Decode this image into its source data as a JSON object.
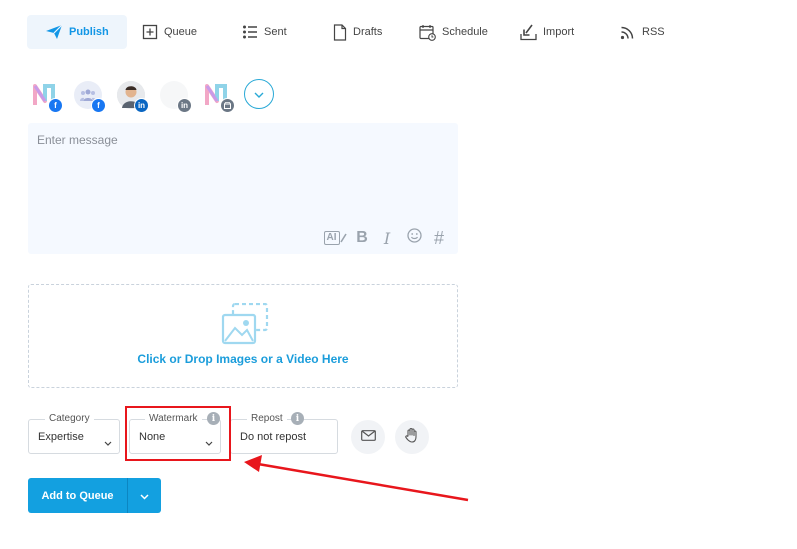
{
  "tabs": {
    "publish": "Publish",
    "queue": "Queue",
    "sent": "Sent",
    "drafts": "Drafts",
    "schedule": "Schedule",
    "import": "Import",
    "rss": "RSS"
  },
  "accounts": [
    {
      "icon": "brand-logo-icon",
      "network": "facebook",
      "badge": "f",
      "badge_color": "#1877f2"
    },
    {
      "icon": "group-icon",
      "network": "facebook",
      "badge": "f",
      "badge_color": "#1877f2"
    },
    {
      "icon": "person-avatar-icon",
      "network": "linkedin",
      "badge": "in",
      "badge_color": "#0a66c2"
    },
    {
      "icon": "empty-avatar-icon",
      "network": "linkedin",
      "badge": "in",
      "badge_color": "#6b7785"
    },
    {
      "icon": "brand-logo-icon",
      "network": "google-business",
      "badge": "g",
      "badge_color": "#6b7785"
    }
  ],
  "message": {
    "placeholder": "Enter message",
    "value": ""
  },
  "toolbar": {
    "ai_label": "AI",
    "bold_label": "B",
    "italic_label": "I",
    "hashtag_label": "#"
  },
  "upload": {
    "text": "Click or Drop Images or a Video Here"
  },
  "category": {
    "label": "Category",
    "value": "Expertise"
  },
  "watermark": {
    "label": "Watermark",
    "value": "None",
    "info": "i"
  },
  "repost": {
    "label": "Repost",
    "value": "Do not repost",
    "info": "i"
  },
  "add_button": {
    "label": "Add to Queue"
  },
  "colors": {
    "accent": "#13a0e0",
    "highlight": "#e8161c",
    "tab_active_bg": "#eef5fc"
  }
}
